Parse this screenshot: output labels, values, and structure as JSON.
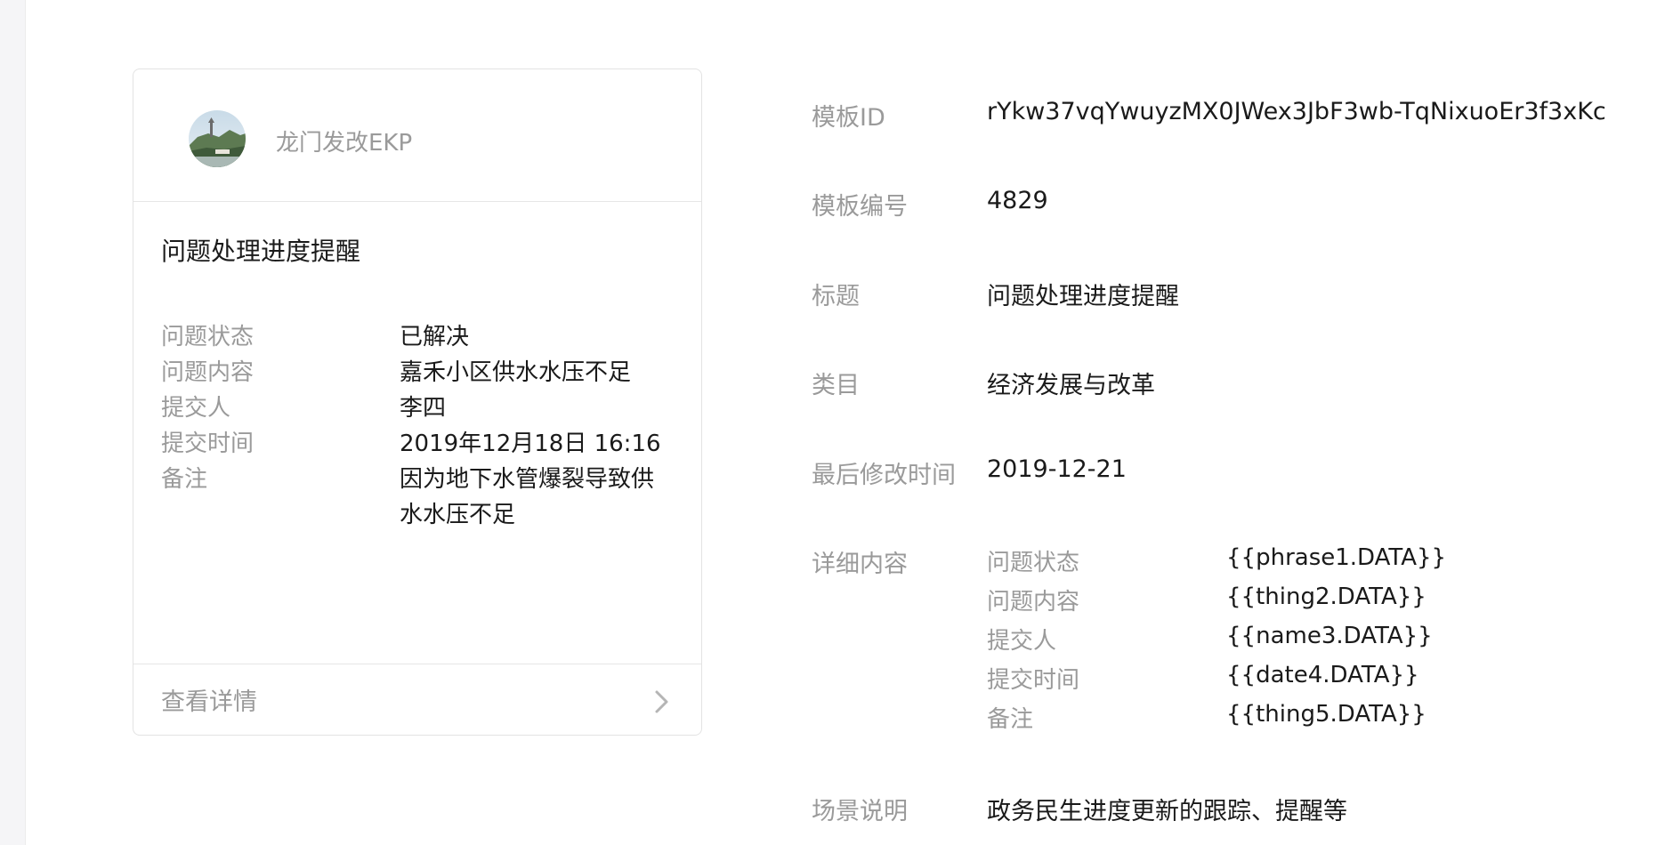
{
  "preview": {
    "account_name": "龙门发改EKP",
    "title": "问题处理进度提醒",
    "fields": [
      {
        "label": "问题状态",
        "value": "已解决"
      },
      {
        "label": "问题内容",
        "value": "嘉禾小区供水水压不足"
      },
      {
        "label": "提交人",
        "value": "李四"
      },
      {
        "label": "提交时间",
        "value": "2019年12月18日 16:16"
      },
      {
        "label": "备注",
        "value": "因为地下水管爆裂导致供水水压不足"
      }
    ],
    "footer_label": "查看详情",
    "icons": {
      "avatar": "account-avatar-icon",
      "chevron": "chevron-right-icon"
    }
  },
  "info": {
    "template_id": {
      "label": "模板ID",
      "value": "rYkw37vqYwuyzMX0JWex3JbF3wb-TqNixuoEr3f3xKc"
    },
    "template_no": {
      "label": "模板编号",
      "value": "4829"
    },
    "title": {
      "label": "标题",
      "value": "问题处理进度提醒"
    },
    "category": {
      "label": "类目",
      "value": "经济发展与改革"
    },
    "modified": {
      "label": "最后修改时间",
      "value": "2019-12-21"
    },
    "details_label": "详细内容",
    "details": [
      {
        "key": "问题状态",
        "value": "{{phrase1.DATA}}"
      },
      {
        "key": "问题内容",
        "value": "{{thing2.DATA}}"
      },
      {
        "key": "提交人",
        "value": "{{name3.DATA}}"
      },
      {
        "key": "提交时间",
        "value": "{{date4.DATA}}"
      },
      {
        "key": "备注",
        "value": "{{thing5.DATA}}"
      }
    ],
    "scenario": {
      "label": "场景说明",
      "value": "政务民生进度更新的跟踪、提醒等"
    }
  },
  "colors": {
    "label_gray": "#9a9a9a",
    "text": "#1a1a1a",
    "border": "#e3e3e3"
  }
}
